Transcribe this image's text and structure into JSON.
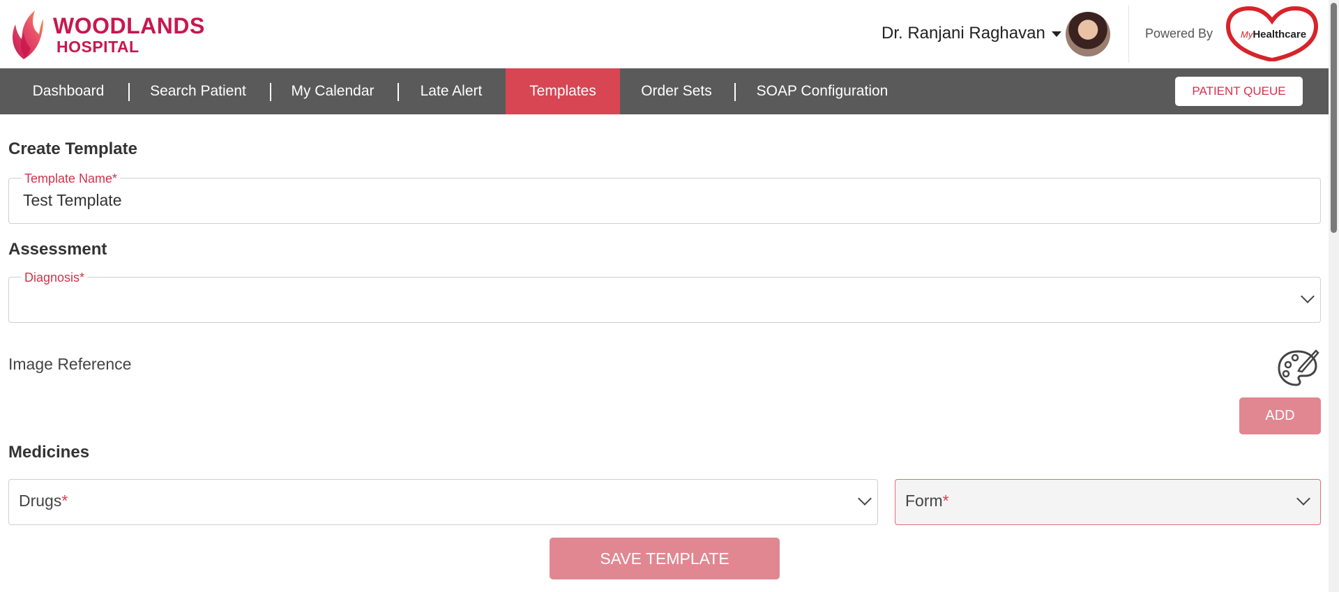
{
  "header": {
    "logo_line1": "WOODLANDS",
    "logo_line2": "HOSPITAL",
    "user_name": "Dr. Ranjani Raghavan",
    "powered_by": "Powered By",
    "mhc_my": "My",
    "mhc_healthcare": "Healthcare"
  },
  "nav": {
    "items": [
      {
        "label": "Dashboard"
      },
      {
        "label": "Search Patient"
      },
      {
        "label": "My Calendar"
      },
      {
        "label": "Late Alert"
      },
      {
        "label": "Templates",
        "active": true
      },
      {
        "label": "Order Sets"
      },
      {
        "label": "SOAP Configuration"
      }
    ],
    "queue_button": "PATIENT QUEUE"
  },
  "form": {
    "title": "Create Template",
    "template_name_label": "Template Name*",
    "template_name_value": "Test Template",
    "assessment_title": "Assessment",
    "diagnosis_label": "Diagnosis*",
    "diagnosis_value": "",
    "image_reference_label": "Image Reference",
    "add_button": "ADD",
    "medicines_title": "Medicines",
    "drugs_label": "Drugs",
    "form_label": "Form",
    "required_mark": "*",
    "save_button": "SAVE TEMPLATE"
  },
  "icons": {
    "user_menu": "caret-down-icon",
    "dropdown": "chevron-down-icon",
    "image_reference": "palette-brush-icon"
  },
  "colors": {
    "brand": "#c8174f",
    "nav_bg": "#5a5a5a",
    "nav_active": "#d84553",
    "button_disabled": "#e18791",
    "required": "#d3314a"
  }
}
